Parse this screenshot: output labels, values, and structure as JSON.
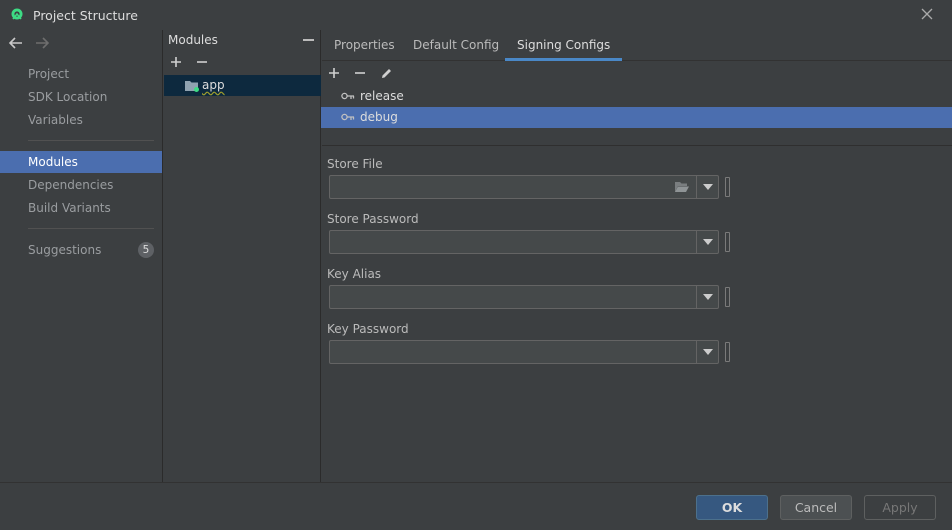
{
  "window": {
    "title": "Project Structure",
    "icon": "android-studio-icon"
  },
  "nav": {
    "back_icon": "arrow-left-icon",
    "forward_icon": "arrow-right-icon",
    "items": [
      {
        "label": "Project"
      },
      {
        "label": "SDK Location"
      },
      {
        "label": "Variables"
      },
      {
        "label": "Modules",
        "selected": true
      },
      {
        "label": "Dependencies"
      },
      {
        "label": "Build Variants"
      },
      {
        "label": "Suggestions",
        "badge": "5"
      }
    ]
  },
  "modules": {
    "header": "Modules",
    "items": [
      {
        "label": "app",
        "icon": "module-folder-icon"
      }
    ]
  },
  "tabs": [
    {
      "label": "Properties"
    },
    {
      "label": "Default Config"
    },
    {
      "label": "Signing Configs",
      "active": true
    }
  ],
  "signing_configs": [
    {
      "label": "release",
      "icon": "key-icon"
    },
    {
      "label": "debug",
      "icon": "key-icon",
      "selected": true
    }
  ],
  "fields": {
    "store_file": {
      "label": "Store File",
      "value": ""
    },
    "store_password": {
      "label": "Store Password",
      "value": ""
    },
    "key_alias": {
      "label": "Key Alias",
      "value": ""
    },
    "key_password": {
      "label": "Key Password",
      "value": ""
    }
  },
  "buttons": {
    "ok": "OK",
    "cancel": "Cancel",
    "apply": "Apply"
  },
  "colors": {
    "background": "#3c3f41",
    "selection": "#4b6eaf",
    "tab_underline": "#4a88c7",
    "ok_button": "#365880"
  }
}
